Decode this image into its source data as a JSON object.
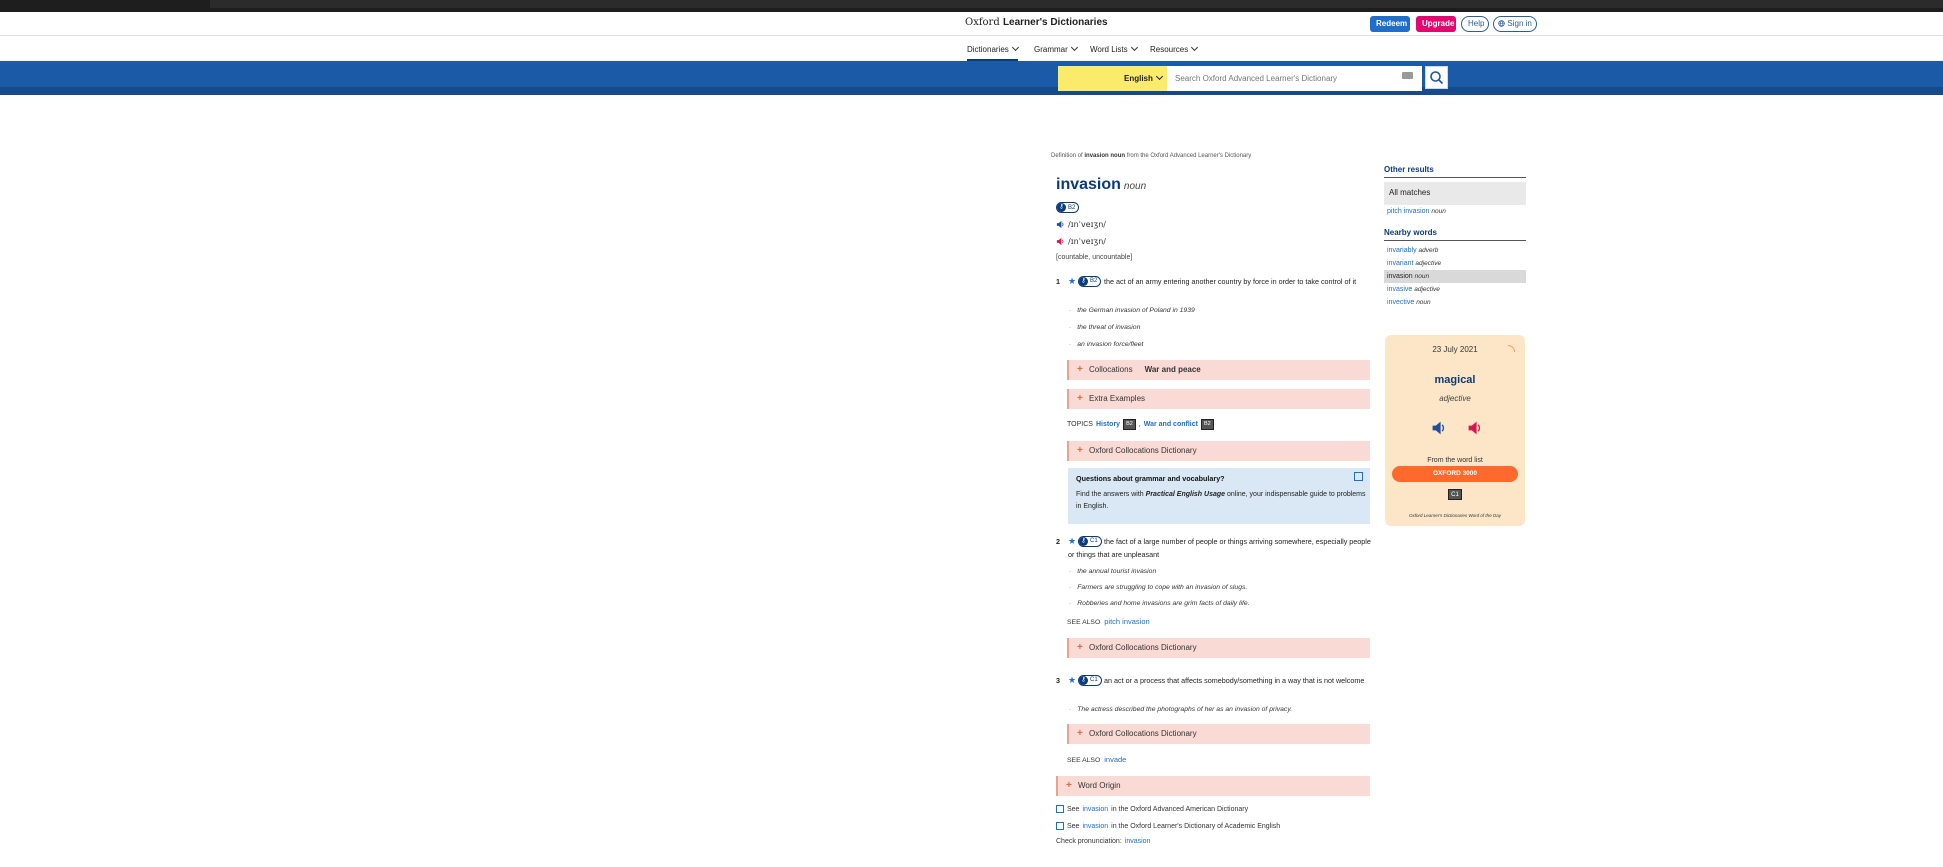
{
  "header": {
    "logo_light": "Oxford",
    "logo_bold": "Learner's Dictionaries",
    "redeem": "Redeem",
    "upgrade": "Upgrade",
    "help": "Help",
    "signin": "Sign in"
  },
  "nav": {
    "items": [
      "Dictionaries",
      "Grammar",
      "Word Lists",
      "Resources"
    ]
  },
  "search": {
    "language": "English",
    "placeholder": "Search Oxford Advanced Learner's Dictionary"
  },
  "entry": {
    "crumb_pre": "Definition of",
    "crumb_word": "invasion noun",
    "crumb_post": "from the Oxford Advanced Learner's Dictionary",
    "headword": "invasion",
    "pos": "noun",
    "level": "B2",
    "pron_uk": "/ɪnˈveɪʒn/",
    "pron_us": "/ɪnˈveɪʒn/",
    "grammar": "[countable, uncountable]"
  },
  "senses": [
    {
      "num": "1",
      "level": "B2",
      "definition": "the act of an army entering another country by force in order to take control of it",
      "examples": [
        "the German invasion of Poland in 1939",
        "the threat of invasion",
        "an invasion force/fleet"
      ]
    },
    {
      "num": "2",
      "level": "C1",
      "definition": "the fact of a large number of people or things arriving somewhere, especially people or things that are unpleasant",
      "examples": [
        "the annual tourist invasion",
        "Farmers are struggling to cope with an invasion of slugs.",
        "Robberies and home invasions are grim facts of daily life."
      ]
    },
    {
      "num": "3",
      "level": "C1",
      "definition": "an act or a process that affects somebody/something in a way that is not welcome",
      "examples": [
        "The actress described the photographs of her as an invasion of privacy."
      ]
    }
  ],
  "boxes": {
    "collocations": "Collocations",
    "collocations_extra": "War and peace",
    "extra_examples": "Extra Examples",
    "ocd": "Oxford Collocations Dictionary",
    "word_origin": "Word Origin"
  },
  "topics": {
    "label": "TOPICS",
    "t1": "History",
    "t1_level": "B2",
    "sep": ",",
    "t2": "War and conflict",
    "t2_level": "B2"
  },
  "help_box": {
    "question": "Questions about grammar and vocabulary?",
    "answer_pre": "Find the answers with",
    "answer_bold": "Practical English Usage",
    "answer_post": "online, your indispensable guide to problems in English."
  },
  "see_also": {
    "label": "SEE ALSO",
    "s2": "pitch invasion",
    "s3": "invade"
  },
  "bottom": {
    "see": "See",
    "word": "invasion",
    "american": "in the Oxford Advanced American Dictionary",
    "academic": "in the Oxford Learner's Dictionary of Academic English",
    "check": "Check pronunciation:",
    "check_word": "invasion"
  },
  "sidebar": {
    "other_results": "Other results",
    "all_matches": "All matches",
    "other_items": [
      {
        "word": "pitch invasion",
        "pos": "noun"
      }
    ],
    "nearby_title": "Nearby words",
    "nearby": [
      {
        "word": "invariably",
        "pos": "adverb"
      },
      {
        "word": "invariant",
        "pos": "adjective"
      },
      {
        "word": "invasion",
        "pos": "noun"
      },
      {
        "word": "invasive",
        "pos": "adjective"
      },
      {
        "word": "invective",
        "pos": "noun"
      }
    ]
  },
  "wotd": {
    "date": "23 July 2021",
    "word": "magical",
    "pos": "adjective",
    "from": "From the word list",
    "list": "OXFORD 3000",
    "level": "C1",
    "credit": "Oxford Learner's Dictionaries Word of the Day"
  },
  "colors": {
    "brand_blue": "#1b5aa6",
    "dark_blue": "#0d3b7a",
    "link": "#1f6ec7",
    "upgrade_pink": "#e3066e",
    "lang_yellow": "#fbeb6d",
    "box_pink": "#fadad5",
    "wotd_bg": "#fde6c7",
    "ox3000_orange": "#ff6a2c"
  }
}
